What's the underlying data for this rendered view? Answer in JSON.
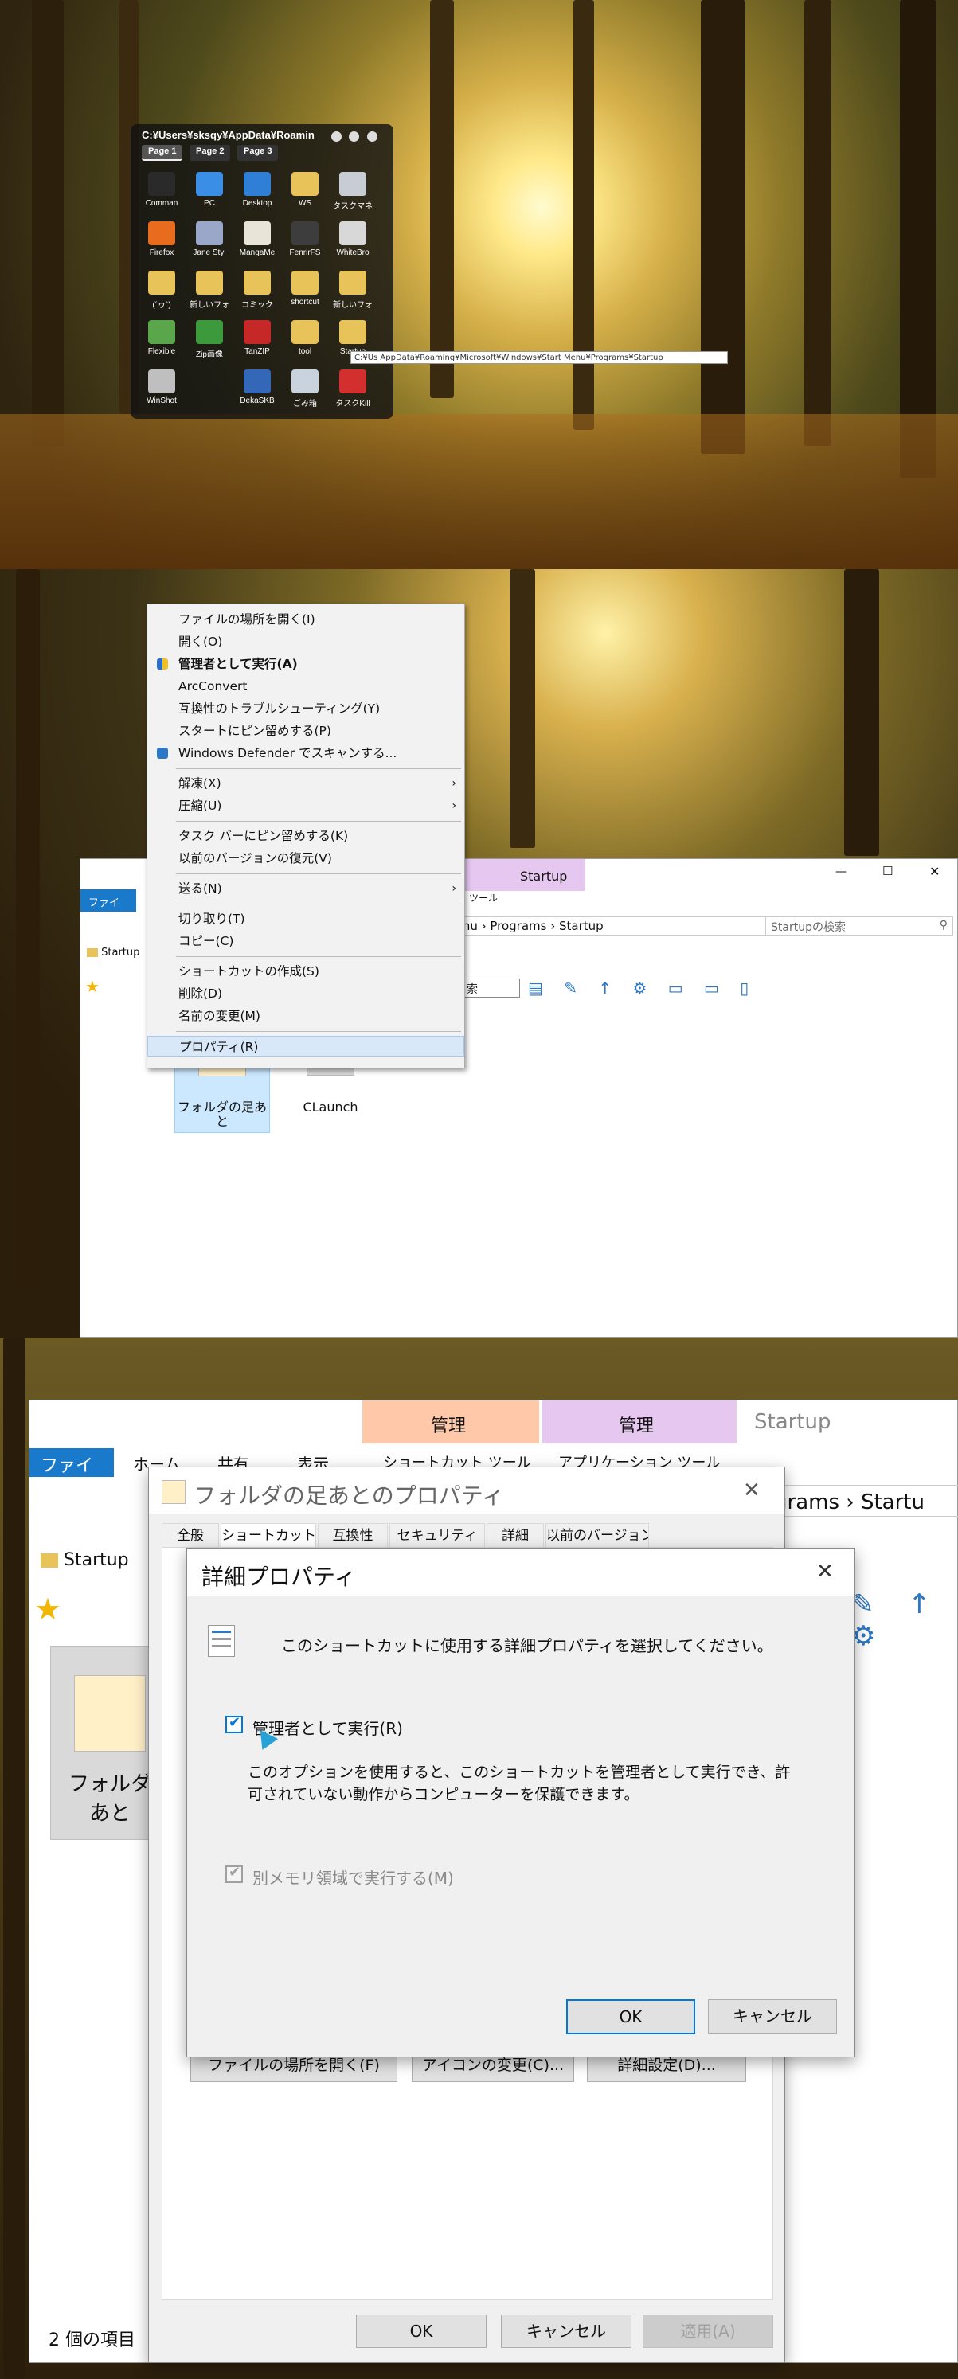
{
  "colors": {
    "accent": "#0078d7",
    "menu_bg": "#f2f2f2",
    "dialog_bg": "#f0f0f0",
    "ribbon_manage_shortcut": "#ffc8a8",
    "ribbon_manage_app": "#e6c7f0"
  },
  "launcher": {
    "title": "C:¥Users¥sksqy¥AppData¥Roamin",
    "tabs": [
      "Page 1",
      "Page 2",
      "Page 3"
    ],
    "icons": [
      {
        "label": "Comman",
        "icon": "terminal-icon",
        "color": "#2a2a2a"
      },
      {
        "label": "PC",
        "icon": "pc-icon",
        "color": "#3a8ee6"
      },
      {
        "label": "Desktop",
        "icon": "desktop-icon",
        "color": "#2f7fd6"
      },
      {
        "label": "WS",
        "icon": "folder-icon",
        "color": "#e8c35a"
      },
      {
        "label": "タスクマネ",
        "icon": "task-manager-icon",
        "color": "#c8ccd4"
      },
      {
        "label": "Firefox",
        "icon": "firefox-icon",
        "color": "#e86b1e"
      },
      {
        "label": "Jane Styl",
        "icon": "jane-style-icon",
        "color": "#9aa7c9"
      },
      {
        "label": "MangaMe",
        "icon": "manga-meeya-icon",
        "color": "#e9e4d8"
      },
      {
        "label": "FenrirFS",
        "icon": "fenrirfs-icon",
        "color": "#3d3d3d"
      },
      {
        "label": "WhiteBro",
        "icon": "white-browser-icon",
        "color": "#d8d8d8"
      },
      {
        "label": "(´ヮ`)",
        "icon": "folder-icon",
        "color": "#e8c35a"
      },
      {
        "label": "新しいフォ",
        "icon": "folder-icon",
        "color": "#e8c35a"
      },
      {
        "label": "コミック",
        "icon": "folder-icon",
        "color": "#e8c35a"
      },
      {
        "label": "shortcut",
        "icon": "folder-icon",
        "color": "#e8c35a"
      },
      {
        "label": "新しいフォ",
        "icon": "folder-icon",
        "color": "#e8c35a"
      },
      {
        "label": "Flexible",
        "icon": "flexible-renamer-icon",
        "color": "#5aa64a"
      },
      {
        "label": "Zip画像",
        "icon": "zip-image-icon",
        "color": "#3c9a3c"
      },
      {
        "label": "TanZIP",
        "icon": "tanzip-icon",
        "color": "#c62828"
      },
      {
        "label": "tool",
        "icon": "folder-icon",
        "color": "#e8c35a"
      },
      {
        "label": "Startup",
        "icon": "folder-icon",
        "color": "#e8c35a"
      },
      {
        "label": "WinShot",
        "icon": "winshot-icon",
        "color": "#bfbfbf"
      },
      {
        "label": "",
        "icon": "empty-slot",
        "color": ""
      },
      {
        "label": "DekaSKB",
        "icon": "dekaskb-icon",
        "color": "#3567b8"
      },
      {
        "label": "ごみ箱",
        "icon": "recycle-bin-icon",
        "color": "#c9d3de"
      },
      {
        "label": "タスクKill",
        "icon": "task-kill-icon",
        "color": "#d32f2f"
      }
    ],
    "path_tooltip": "C:¥Us                AppData¥Roaming¥Microsoft¥Windows¥Start Menu¥Programs¥Startup"
  },
  "context_menu": {
    "items": [
      {
        "label": "ファイルの場所を開く(I)"
      },
      {
        "label": "開く(O)"
      },
      {
        "label": "管理者として実行(A)",
        "bold": true,
        "icon": "shield-icon"
      },
      {
        "label": "ArcConvert"
      },
      {
        "label": "互換性のトラブルシューティング(Y)"
      },
      {
        "label": "スタートにピン留めする(P)"
      },
      {
        "label": "Windows Defender でスキャンする...",
        "icon": "defender-icon"
      },
      {
        "label": "解凍(X)",
        "submenu": true
      },
      {
        "label": "圧縮(U)",
        "submenu": true
      },
      {
        "label": "タスク バーにピン留めする(K)"
      },
      {
        "label": "以前のバージョンの復元(V)"
      },
      {
        "label": "送る(N)",
        "submenu": true
      },
      {
        "label": "切り取り(T)"
      },
      {
        "label": "コピー(C)"
      },
      {
        "label": "ショートカットの作成(S)"
      },
      {
        "label": "削除(D)"
      },
      {
        "label": "名前の変更(M)"
      },
      {
        "label": "プロパティ(R)",
        "hover": true
      }
    ],
    "arrow": "›"
  },
  "explorer1": {
    "file_tab": "ファイル",
    "app_tools": "ツール",
    "title": "Startup",
    "path": "t Menu › Programs › Startup",
    "search_placeholder": "Startupの検索",
    "nav_item": "Startup",
    "search_box_partial": "索",
    "files": [
      {
        "label": "フォルダの足あと"
      },
      {
        "label": "CLaunch"
      }
    ],
    "window_buttons": {
      "min": "—",
      "max": "☐",
      "close": "✕"
    }
  },
  "explorer2": {
    "manage1": "管理",
    "manage2": "管理",
    "title": "Startup",
    "tabs": [
      "ファイル",
      "ホーム",
      "共有",
      "表示"
    ],
    "shortcut_tools": "ショートカット ツール",
    "app_tools": "アプリケーション ツール",
    "path": "rograms › Startu",
    "nav_item": "Startup",
    "file_label_1": "フォルダ",
    "file_label_2": "あと",
    "status": "2 個の項目"
  },
  "properties_dialog": {
    "title": "フォルダの足あとのプロパティ",
    "tabs": [
      "全般",
      "ショートカット",
      "互換性",
      "セキュリティ",
      "詳細",
      "以前のバージョン"
    ],
    "buttons": {
      "open_location": "ファイルの場所を開く(F)",
      "change_icon": "アイコンの変更(C)...",
      "advanced": "詳細設定(D)..."
    },
    "footer": {
      "ok": "OK",
      "cancel": "キャンセル",
      "apply": "適用(A)"
    },
    "close": "✕"
  },
  "advanced_dialog": {
    "title": "詳細プロパティ",
    "description": "このショートカットに使用する詳細プロパティを選択してください。",
    "run_as_admin": {
      "label": "管理者として実行(R)",
      "checked": true
    },
    "explanation_line1": "このオプションを使用すると、このショートカットを管理者として実行でき、許",
    "explanation_line2": "可されていない動作からコンピューターを保護できます。",
    "separate_memory": {
      "label": "別メモリ領域で実行する(M)",
      "checked": true,
      "disabled": true
    },
    "ok": "OK",
    "cancel": "キャンセル",
    "close": "✕"
  }
}
